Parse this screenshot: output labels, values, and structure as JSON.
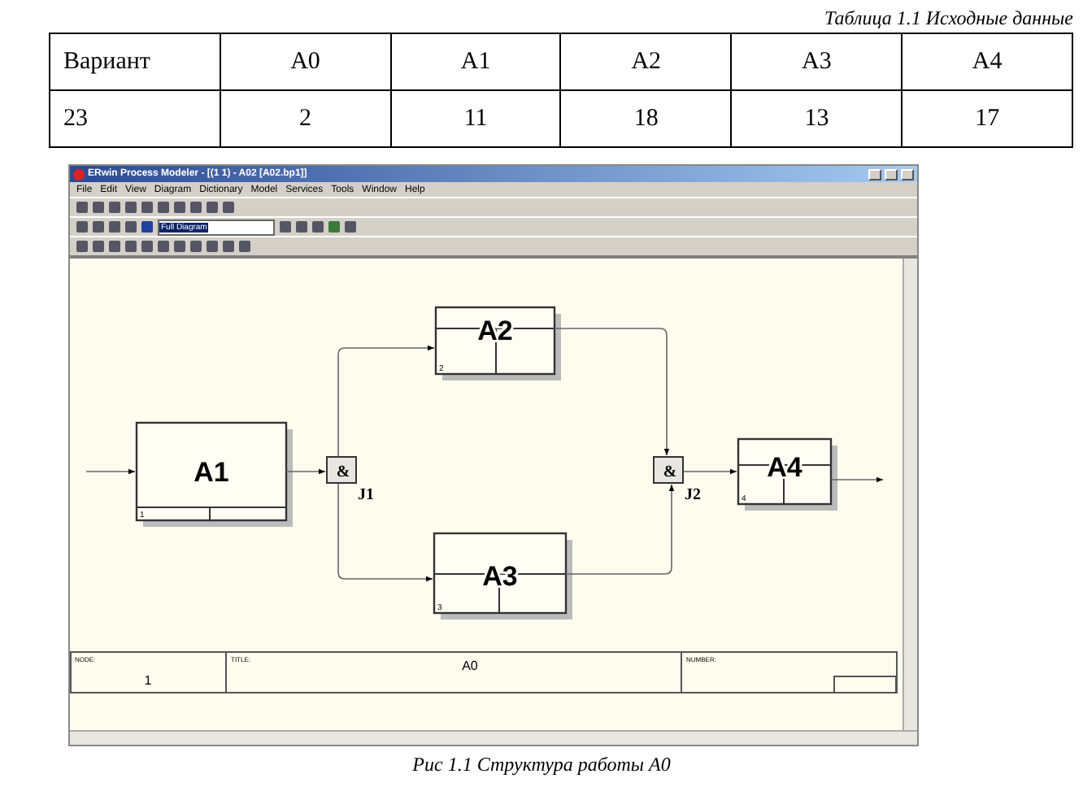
{
  "table": {
    "caption": "Таблица 1.1 Исходные данные",
    "rows": [
      [
        "Вариант",
        "A0",
        "A1",
        "A2",
        "A3",
        "A4"
      ],
      [
        "23",
        "2",
        "11",
        "18",
        "13",
        "17"
      ]
    ]
  },
  "screenshot": {
    "window": {
      "title": "ERwin Process Modeler - [(1 1) - A02 [A02.bp1]]"
    },
    "menu": [
      "File",
      "Edit",
      "View",
      "Diagram",
      "Dictionary",
      "Model",
      "Services",
      "Tools",
      "Window",
      "Help"
    ],
    "zoom_select": {
      "value": "Full Diagram"
    },
    "diagram": {
      "boxes": [
        {
          "label": "A1",
          "number": "1"
        },
        {
          "label": "A2",
          "number": "2"
        },
        {
          "label": "A3",
          "number": "3"
        },
        {
          "label": "A4",
          "number": "4"
        }
      ],
      "junctions": [
        {
          "symbol": "&",
          "label": "J1"
        },
        {
          "symbol": "&",
          "label": "J2"
        }
      ]
    },
    "title_block": {
      "node_label": "NODE:",
      "node": "1",
      "title_label": "TITLE:",
      "title": "A0",
      "number_label": "NUMBER:"
    }
  },
  "caption": "Рис 1.1 Структура работы A0"
}
